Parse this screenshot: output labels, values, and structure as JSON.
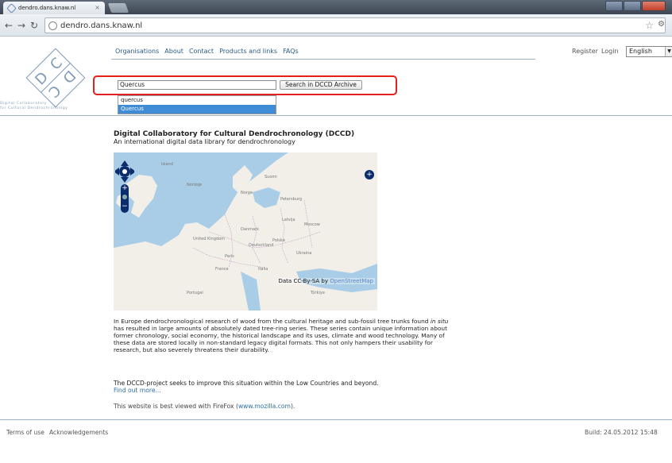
{
  "browser": {
    "tab_title": "dendro.dans.knaw.nl",
    "address": "dendro.dans.knaw.nl"
  },
  "logo": {
    "letters": "DC DC",
    "tagline_line1": "Digital          Collaboratory",
    "tagline_line2": "for Cultural Dendrochronology"
  },
  "nav": {
    "items": [
      "Organisations",
      "About",
      "Contact",
      "Products and links",
      "FAQs"
    ],
    "register": "Register",
    "login": "Login",
    "language": "English"
  },
  "search": {
    "value": "Quercus",
    "button": "Search in DCCD Archive",
    "suggestions": [
      "quercus",
      "Quercus"
    ],
    "selected_index": 1
  },
  "content": {
    "title": "Digital Collaboratory for Cultural Dendrochronology (DCCD)",
    "subtitle": "An international digital data library for dendrochronology",
    "map_attribution_prefix": "Data CC-By-SA by",
    "map_attribution_link": "OpenStreetMap",
    "para1_a": "In Europe dendrochronological research of wood from the cultural heritage and sub-fossil tree trunks found ",
    "para1_italic": "in situ",
    "para1_b": " has resulted in large amounts of absolutely dated tree-ring series. These series contain unique information about former chronology, social economy, the historical landscape and its uses, climate and wood technology. Many of these data are stored locally in non-standard legacy digital formats. This not only hampers their usability for research, but also severely threatens their durability.",
    "para2": "The DCCD-project seeks to improve this situation within the Low Countries and beyond.",
    "find_more": "Find out more...",
    "best_view_prefix": "This website is best viewed with FireFox (",
    "best_view_link": "www.mozilla.com",
    "best_view_suffix": ")."
  },
  "footer": {
    "terms": "Terms of use",
    "ack": "Acknowledgements",
    "build": "Build: 24.05.2012 15:48"
  },
  "colors": {
    "highlight": "#e32020",
    "link": "#2d6fa8",
    "selected": "#3e8bd6"
  }
}
